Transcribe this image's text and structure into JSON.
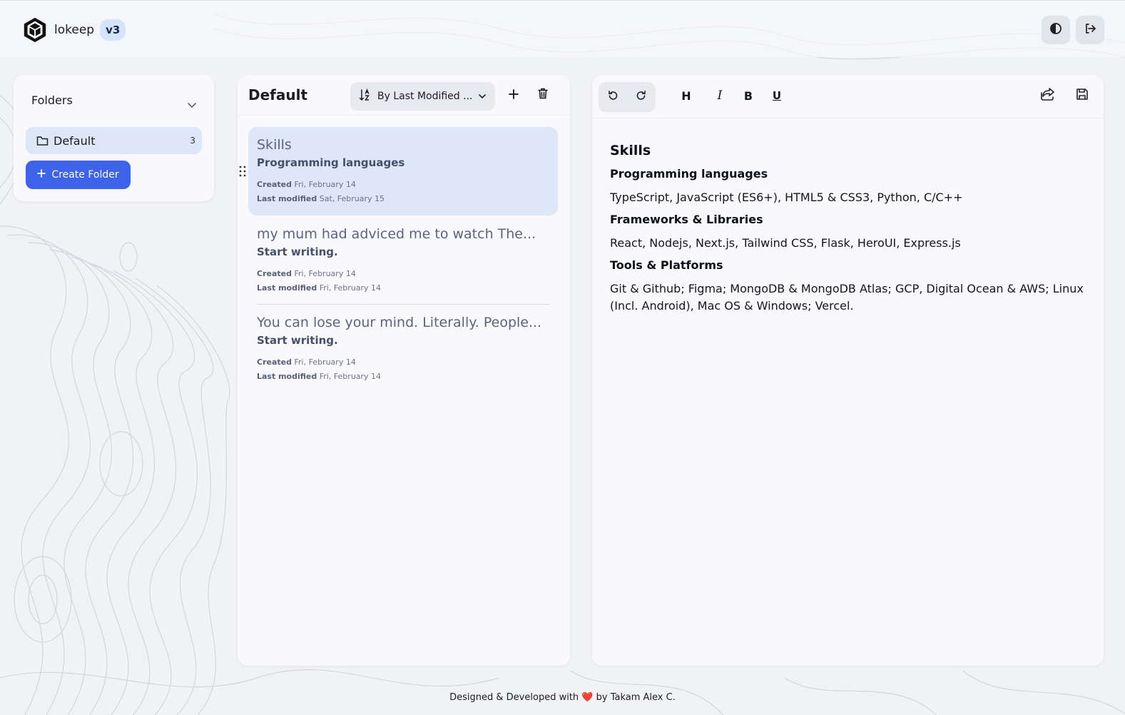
{
  "app": {
    "name": "lokeep",
    "version": "v3",
    "logo_icon": "hexagon-cube-icon",
    "theme_toggle_icon": "contrast-icon",
    "logout_icon": "logout-icon"
  },
  "folders_panel": {
    "title": "Folders",
    "items": [
      {
        "name": "Default",
        "count": "3",
        "icon": "folder-icon"
      }
    ],
    "create_label": "Create Folder"
  },
  "notes_panel": {
    "folder_title": "Default",
    "sort_label": "By Last Modified ...",
    "created_label": "Created",
    "modified_label": "Last modified",
    "notes": [
      {
        "title": "Skills",
        "subtitle": "Programming languages",
        "created": "Fri, February 14",
        "modified": "Sat, February 15"
      },
      {
        "title": "my mum had adviced me to watch The...",
        "subtitle": "Start writing.",
        "created": "Fri, February 14",
        "modified": "Fri, February 14"
      },
      {
        "title": "You can lose your mind. Literally. People...",
        "subtitle": "Start writing.",
        "created": "Fri, February 14",
        "modified": "Fri, February 14"
      }
    ]
  },
  "editor": {
    "toolbar": {
      "undo_icon": "undo-icon",
      "redo_icon": "redo-icon",
      "heading": "H",
      "italic": "I",
      "bold": "B",
      "underline": "U",
      "share_icon": "share-icon",
      "save_icon": "save-icon"
    },
    "content": {
      "h1": "Skills",
      "s1_title": "Programming languages",
      "s1_body": "TypeScript, JavaScript (ES6+), HTML5 & CSS3, Python, C/C++",
      "s2_title": "Frameworks & Libraries",
      "s2_body": "React, Nodejs, Next.js, Tailwind CSS, Flask, HeroUI, Express.js",
      "s3_title": "Tools & Platforms",
      "s3_body": "Git & Github; Figma; MongoDB & MongoDB Atlas; GCP, Digital Ocean & AWS; Linux (Incl. Android), Mac OS & Windows; Vercel."
    }
  },
  "footer": {
    "before": "Designed & Developed with",
    "heart": "❤️",
    "after": "by Takam Alex C."
  },
  "colors": {
    "accent": "#3d63ea",
    "selected_bg": "#dde7f7",
    "badge_bg": "#d6e4fb"
  }
}
